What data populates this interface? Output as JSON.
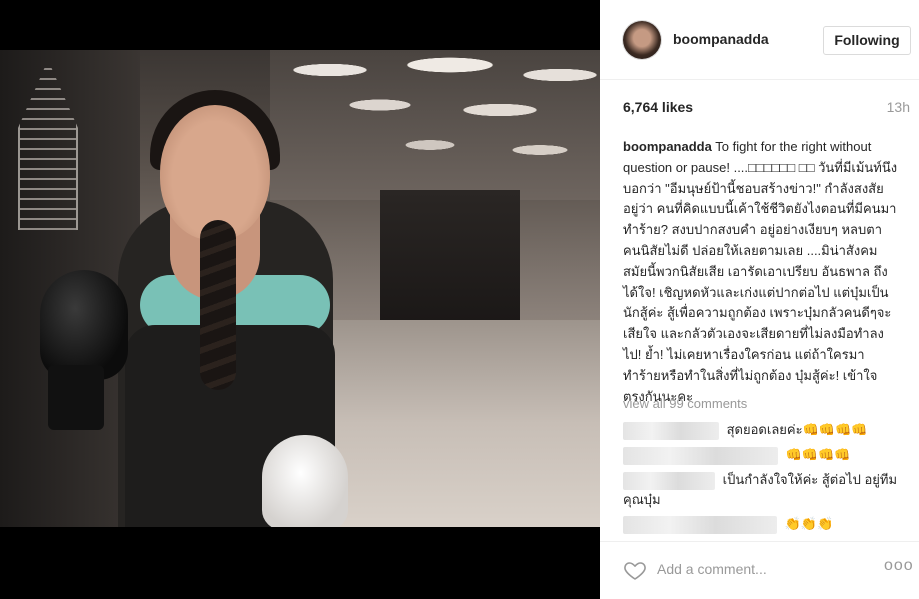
{
  "post": {
    "username": "boompanadda",
    "follow_label": "Following",
    "likes": "6,764 likes",
    "time_ago": "13h",
    "caption_user": "boompanadda",
    "caption_text": "To fight for the right without question or pause! ....□□□□□□ □□ วันที่มีเม้นท์นึงบอกว่า \"อีมนุษย์ป้านี้ชอบสร้างข่าว!\" กำลังสงสัยอยู่ว่า คนที่คิดแบบนี้เค้าใช้ชีวิตยังไงตอนที่มีคนมาทำร้าย? สงบปากสงบคำ อยู่อย่างเงียบๆ หลบตาคนนิสัยไม่ดี ปล่อยให้เลยตามเลย ....มิน่าสังคมสมัยนี้พวกนิสัยเสีย เอารัดเอาเปรียบ อันธพาล ถึงได้ใจ! เชิญหดหัวและเก่งแต่ปากต่อไป แต่บุ๋มเป็นนักสู้ค่ะ สู้เพื่อความถูกต้อง เพราะบุ๋มกลัวคนดีๆจะเสียใจ และกลัวตัวเองจะเสียดายที่ไม่ลงมือทำลงไป! ย้ำ! ไม่เคยหาเรื่องใครก่อน แต่ถ้าใครมาทำร้ายหรือทำในสิ่งที่ไม่ถูกต้อง บุ๋มสู้ค่ะ! เข้าใจตรงกันนะคะ",
    "view_all": "view all 99 comments"
  },
  "comments": [
    {
      "text": "สุดยอดเลยค่ะ👊👊👊👊"
    },
    {
      "text": "👊👊👊👊"
    },
    {
      "text": "เป็นกำลังใจให้ค่ะ สู้ต่อไป อยู่ทีมคุณบุ๋ม"
    },
    {
      "text": "👏👏👏"
    }
  ],
  "footer": {
    "add_comment_placeholder": "Add a comment...",
    "more_label": "ooo"
  },
  "colors": {
    "text": "#262626",
    "muted": "#999999",
    "border": "#efefef",
    "media_bg": "#000000"
  },
  "icons": {
    "like": "heart-icon",
    "options": "more-options-icon"
  }
}
